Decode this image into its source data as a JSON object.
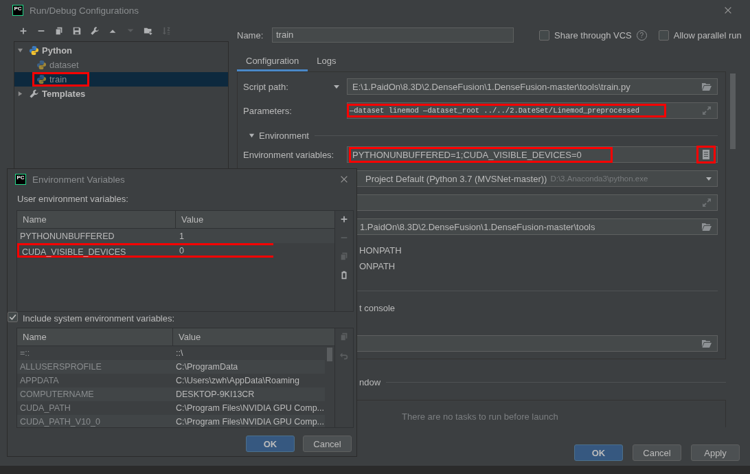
{
  "window": {
    "logo": "PC",
    "title": "Run/Debug Configurations"
  },
  "toolbar": [
    {
      "kind": "add",
      "disabled": false
    },
    {
      "kind": "remove",
      "disabled": false
    },
    {
      "kind": "copy",
      "disabled": false
    },
    {
      "kind": "save",
      "disabled": false
    },
    {
      "kind": "wrench",
      "disabled": false
    },
    {
      "kind": "up",
      "disabled": false
    },
    {
      "kind": "down",
      "disabled": true
    },
    {
      "kind": "folder-add",
      "disabled": false
    },
    {
      "kind": "sort",
      "disabled": true
    }
  ],
  "tree": [
    {
      "kind": "python",
      "label": "Python",
      "expanded": true,
      "selected": false,
      "children": [
        {
          "kind": "python",
          "label": "dataset",
          "selected": false,
          "highlighted": false
        },
        {
          "kind": "python",
          "label": "train",
          "selected": true,
          "highlighted": true
        }
      ]
    },
    {
      "kind": "templates",
      "label": "Templates",
      "expanded": false,
      "selected": false
    }
  ],
  "name_field": {
    "label": "Name:",
    "value": "train"
  },
  "options": [
    {
      "label": "Share through VCS",
      "checked": false,
      "help": "?"
    },
    {
      "label": "Allow parallel run",
      "checked": false
    }
  ],
  "tabs": [
    {
      "label": "Configuration",
      "selected": true
    },
    {
      "label": "Logs",
      "selected": false
    }
  ],
  "config_rows": [
    {
      "kind": "path",
      "label": "Script path:",
      "value": "E:\\1.PaidOn\\8.3D\\2.DenseFusion\\1.DenseFusion-master\\tools\\train.py",
      "highlighted": false
    },
    {
      "kind": "expand",
      "label": "Parameters:",
      "value": "—dataset linemod —dataset_root ../../2.DateSet/Linemod_preprocessed",
      "highlighted": true
    }
  ],
  "environment": {
    "label": "Environment",
    "expanded": true,
    "variables": {
      "label": "Environment variables:",
      "value": "PYTHONUNBUFFERED=1;CUDA_VISIBLE_DEVICES=0",
      "highlighted": true,
      "button_highlighted": true
    }
  },
  "covered_rows": [
    {
      "kind": "combo",
      "value": "Project Default (Python 3.7 (MVSNet-master))",
      "hint": "D:\\3.Anaconda3\\python.exe"
    },
    {
      "kind": "expand"
    },
    {
      "kind": "path",
      "value": "1.PaidOn\\8.3D\\2.DenseFusion\\1.DenseFusion-master\\tools"
    },
    {
      "kind": "text",
      "value": "HONPATH"
    },
    {
      "kind": "text",
      "value": "ONPATH"
    },
    {
      "kind": "divider"
    },
    {
      "kind": "text",
      "value": "t console"
    },
    {
      "kind": "path"
    }
  ],
  "section_tail": {
    "label": "ndow"
  },
  "before_launch": {
    "empty_text": "There are no tasks to run before launch"
  },
  "buttons": [
    {
      "label": "OK",
      "primary": true
    },
    {
      "label": "Cancel",
      "primary": false
    },
    {
      "label": "Apply",
      "primary": false
    }
  ],
  "env_dialog": {
    "logo": "PC",
    "title": "Environment Variables",
    "user_label": "User environment variables:",
    "user_table": {
      "columns": [
        "Name",
        "Value"
      ],
      "rows": [
        {
          "name": "PYTHONUNBUFFERED",
          "value": "1",
          "highlighted": false
        },
        {
          "name": "CUDA_VISIBLE_DEVICES",
          "value": "0",
          "highlighted": true
        }
      ],
      "tools": [
        {
          "kind": "add",
          "disabled": false
        },
        {
          "kind": "remove",
          "disabled": true
        },
        {
          "kind": "copy",
          "disabled": true
        },
        {
          "kind": "paste",
          "disabled": false
        }
      ]
    },
    "include_system": {
      "label": "Include system environment variables:",
      "checked": true
    },
    "system_table": {
      "columns": [
        "Name",
        "Value"
      ],
      "rows": [
        {
          "name": "=::",
          "value": "::\\"
        },
        {
          "name": "ALLUSERSPROFILE",
          "value": "C:\\ProgramData"
        },
        {
          "name": "APPDATA",
          "value": "C:\\Users\\zwh\\AppData\\Roaming"
        },
        {
          "name": "COMPUTERNAME",
          "value": "DESKTOP-9KI13CR"
        },
        {
          "name": "CUDA_PATH",
          "value": "C:\\Program Files\\NVIDIA GPU Comp..."
        },
        {
          "name": "CUDA_PATH_V10_0",
          "value": "C:\\Program Files\\NVIDIA GPU Comp..."
        }
      ],
      "tools": [
        {
          "kind": "copy",
          "disabled": true
        },
        {
          "kind": "undo",
          "disabled": true
        }
      ]
    },
    "buttons": [
      {
        "label": "OK",
        "primary": true
      },
      {
        "label": "Cancel",
        "primary": false
      }
    ]
  }
}
